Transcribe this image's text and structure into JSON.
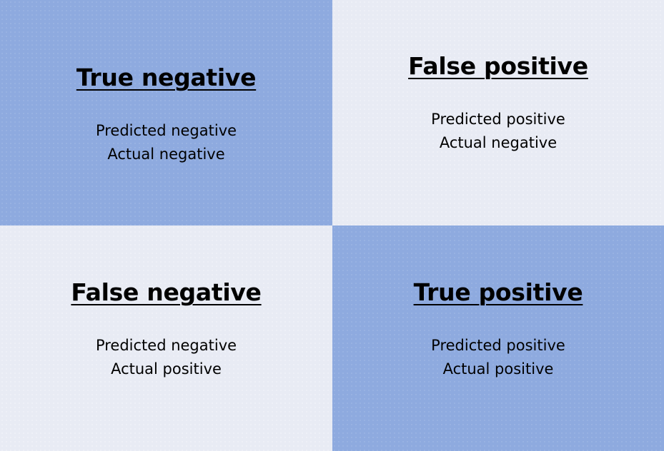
{
  "colors": {
    "emphasis_cell": "#8eaadf",
    "plain_cell": "#e8ebf4",
    "text": "#000000"
  },
  "cells": {
    "true_negative": {
      "title": "True negative",
      "line1": "Predicted negative",
      "line2": "Actual negative"
    },
    "false_positive": {
      "title": "False positive",
      "line1": "Predicted positive",
      "line2": "Actual negative"
    },
    "false_negative": {
      "title": "False negative",
      "line1": "Predicted negative",
      "line2": "Actual positive"
    },
    "true_positive": {
      "title": "True positive",
      "line1": "Predicted positive",
      "line2": "Actual positive"
    }
  }
}
